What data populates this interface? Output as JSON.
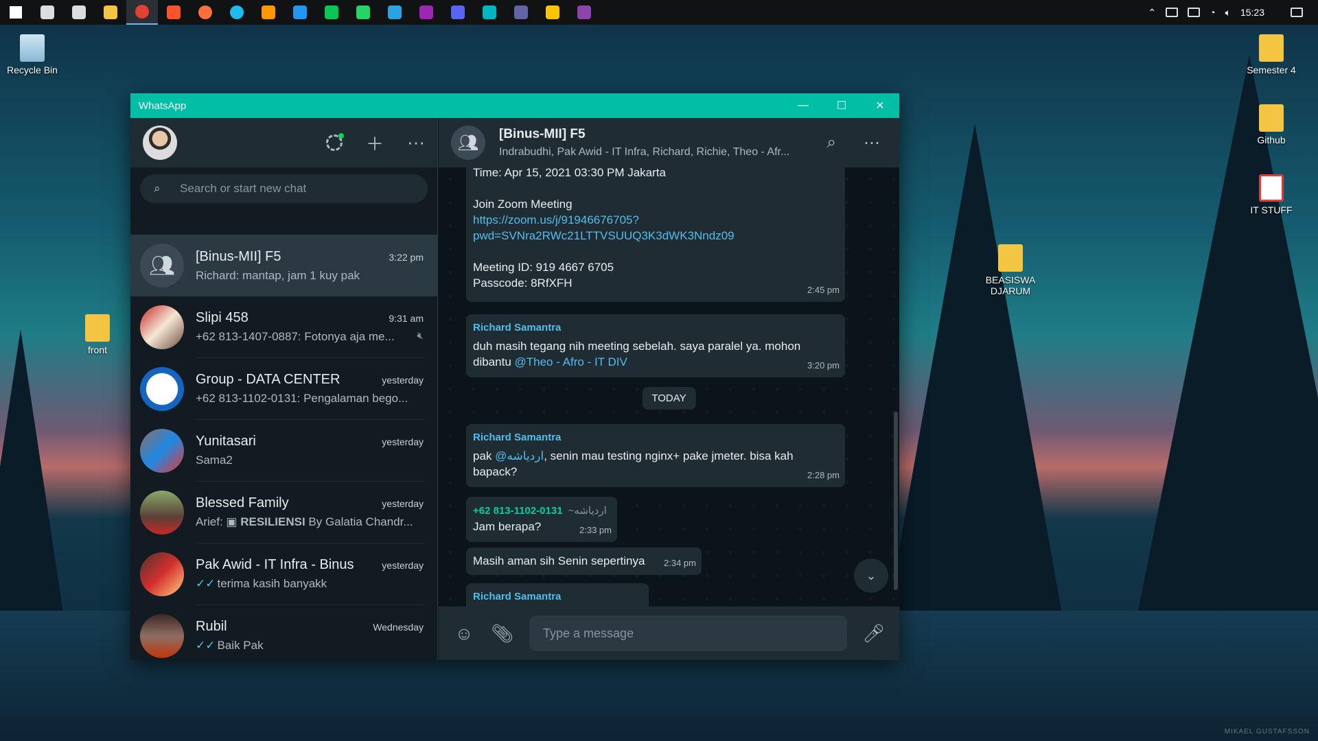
{
  "taskbar": {
    "apps": [
      {
        "name": "windows-start",
        "color": "#ffffff"
      },
      {
        "name": "search",
        "color": "#dddddd"
      },
      {
        "name": "task-view",
        "color": "#dddddd"
      },
      {
        "name": "file-explorer",
        "color": "#f4c542"
      },
      {
        "name": "chrome",
        "color": "#e34133"
      },
      {
        "name": "brave",
        "color": "#fb542b"
      },
      {
        "name": "firefox",
        "color": "#ff7139"
      },
      {
        "name": "edge",
        "color": "#1ebbee"
      },
      {
        "name": "sublime",
        "color": "#ff9800"
      },
      {
        "name": "vscode",
        "color": "#2196f3"
      },
      {
        "name": "line",
        "color": "#06c755"
      },
      {
        "name": "whatsapp",
        "color": "#25d366"
      },
      {
        "name": "telegram",
        "color": "#2aa3df"
      },
      {
        "name": "app-colorful",
        "color": "#9c27b0"
      },
      {
        "name": "discord",
        "color": "#5865f2"
      },
      {
        "name": "app-teal",
        "color": "#00b7c3"
      },
      {
        "name": "teams",
        "color": "#6264a7"
      },
      {
        "name": "sticky-notes",
        "color": "#ffc400"
      },
      {
        "name": "github-desktop",
        "color": "#8e44ad"
      }
    ],
    "clock": "15:23"
  },
  "desktop": {
    "recycle_bin": "Recycle Bin",
    "front": "front",
    "semester4": "Semester 4",
    "github": "Github",
    "it_stuff": "IT STUFF",
    "beasiswa_line1": "BEASISWA",
    "beasiswa_line2": "DJARUM",
    "watermark": "MIKAEL GUSTAFSSON"
  },
  "window": {
    "title": "WhatsApp",
    "min": "—",
    "max": "☐",
    "close": "✕"
  },
  "left": {
    "search_placeholder": "Search or start new chat",
    "chats": [
      {
        "name": "[Binus-MII] F5",
        "time": "3:22 pm",
        "preview": "Richard: mantap, jam 1 kuy pak"
      },
      {
        "name": "Slipi 458",
        "time": "9:31 am",
        "preview": "+62 813-1407-0887: Fotonya aja me..."
      },
      {
        "name": "Group - DATA CENTER",
        "time": "yesterday",
        "preview": "+62 813-1102-0131: Pengalaman bego..."
      },
      {
        "name": "Yunitasari",
        "time": "yesterday",
        "preview": "Sama2"
      },
      {
        "name": "Blessed Family",
        "time": "yesterday",
        "preview_prefix": "Arief: ",
        "preview_bold": "RESILIENSI",
        "preview_rest": " By Galatia Chandr..."
      },
      {
        "name": "Pak Awid - IT Infra - Binus",
        "time": "yesterday",
        "preview": "terima kasih banyakk"
      },
      {
        "name": "Rubil",
        "time": "Wednesday",
        "preview": "Baik Pak"
      }
    ]
  },
  "right": {
    "title": "[Binus-MII] F5",
    "subtitle": "Indrabudhi, Pak Awid - IT Infra, Richard, Richie, Theo - Afr...",
    "messages": {
      "m1_time_line": "Time: Apr 15, 2021 03:30 PM Jakarta",
      "m1_join": "Join Zoom Meeting",
      "m1_link1": "https://zoom.us/j/91946676705?",
      "m1_link2": "pwd=SVNra2RWc21LTTVSUUQ3K3dWK3Nndz09",
      "m1_meeting_id": "Meeting ID: 919 4667 6705",
      "m1_passcode": "Passcode: 8RfXFH",
      "m1_time": "2:45 pm",
      "m2_sender": "Richard Samantra",
      "m2_text": "duh masih tegang nih meeting sebelah. saya paralel ya. mohon dibantu ",
      "m2_mention": "@Theo - Afro - IT DIV",
      "m2_time": "3:20 pm",
      "date_pill": "TODAY",
      "m3_sender": "Richard Samantra",
      "m3_pre": "pak ",
      "m3_mention": "@اردياشه",
      "m3_post": ", senin mau testing nginx+ pake jmeter. bisa kah bapack?",
      "m3_time": "2:28 pm",
      "m4_sender": "+62 813-1102-0131",
      "m4_alias": "~اردياشه",
      "m4_text": "Jam berapa?",
      "m4_time": "2:33 pm",
      "m5_text": "Masih aman sih Senin sepertinya",
      "m5_time": "2:34 pm",
      "m6_sender": "Richard Samantra"
    },
    "input_placeholder": "Type a message"
  }
}
